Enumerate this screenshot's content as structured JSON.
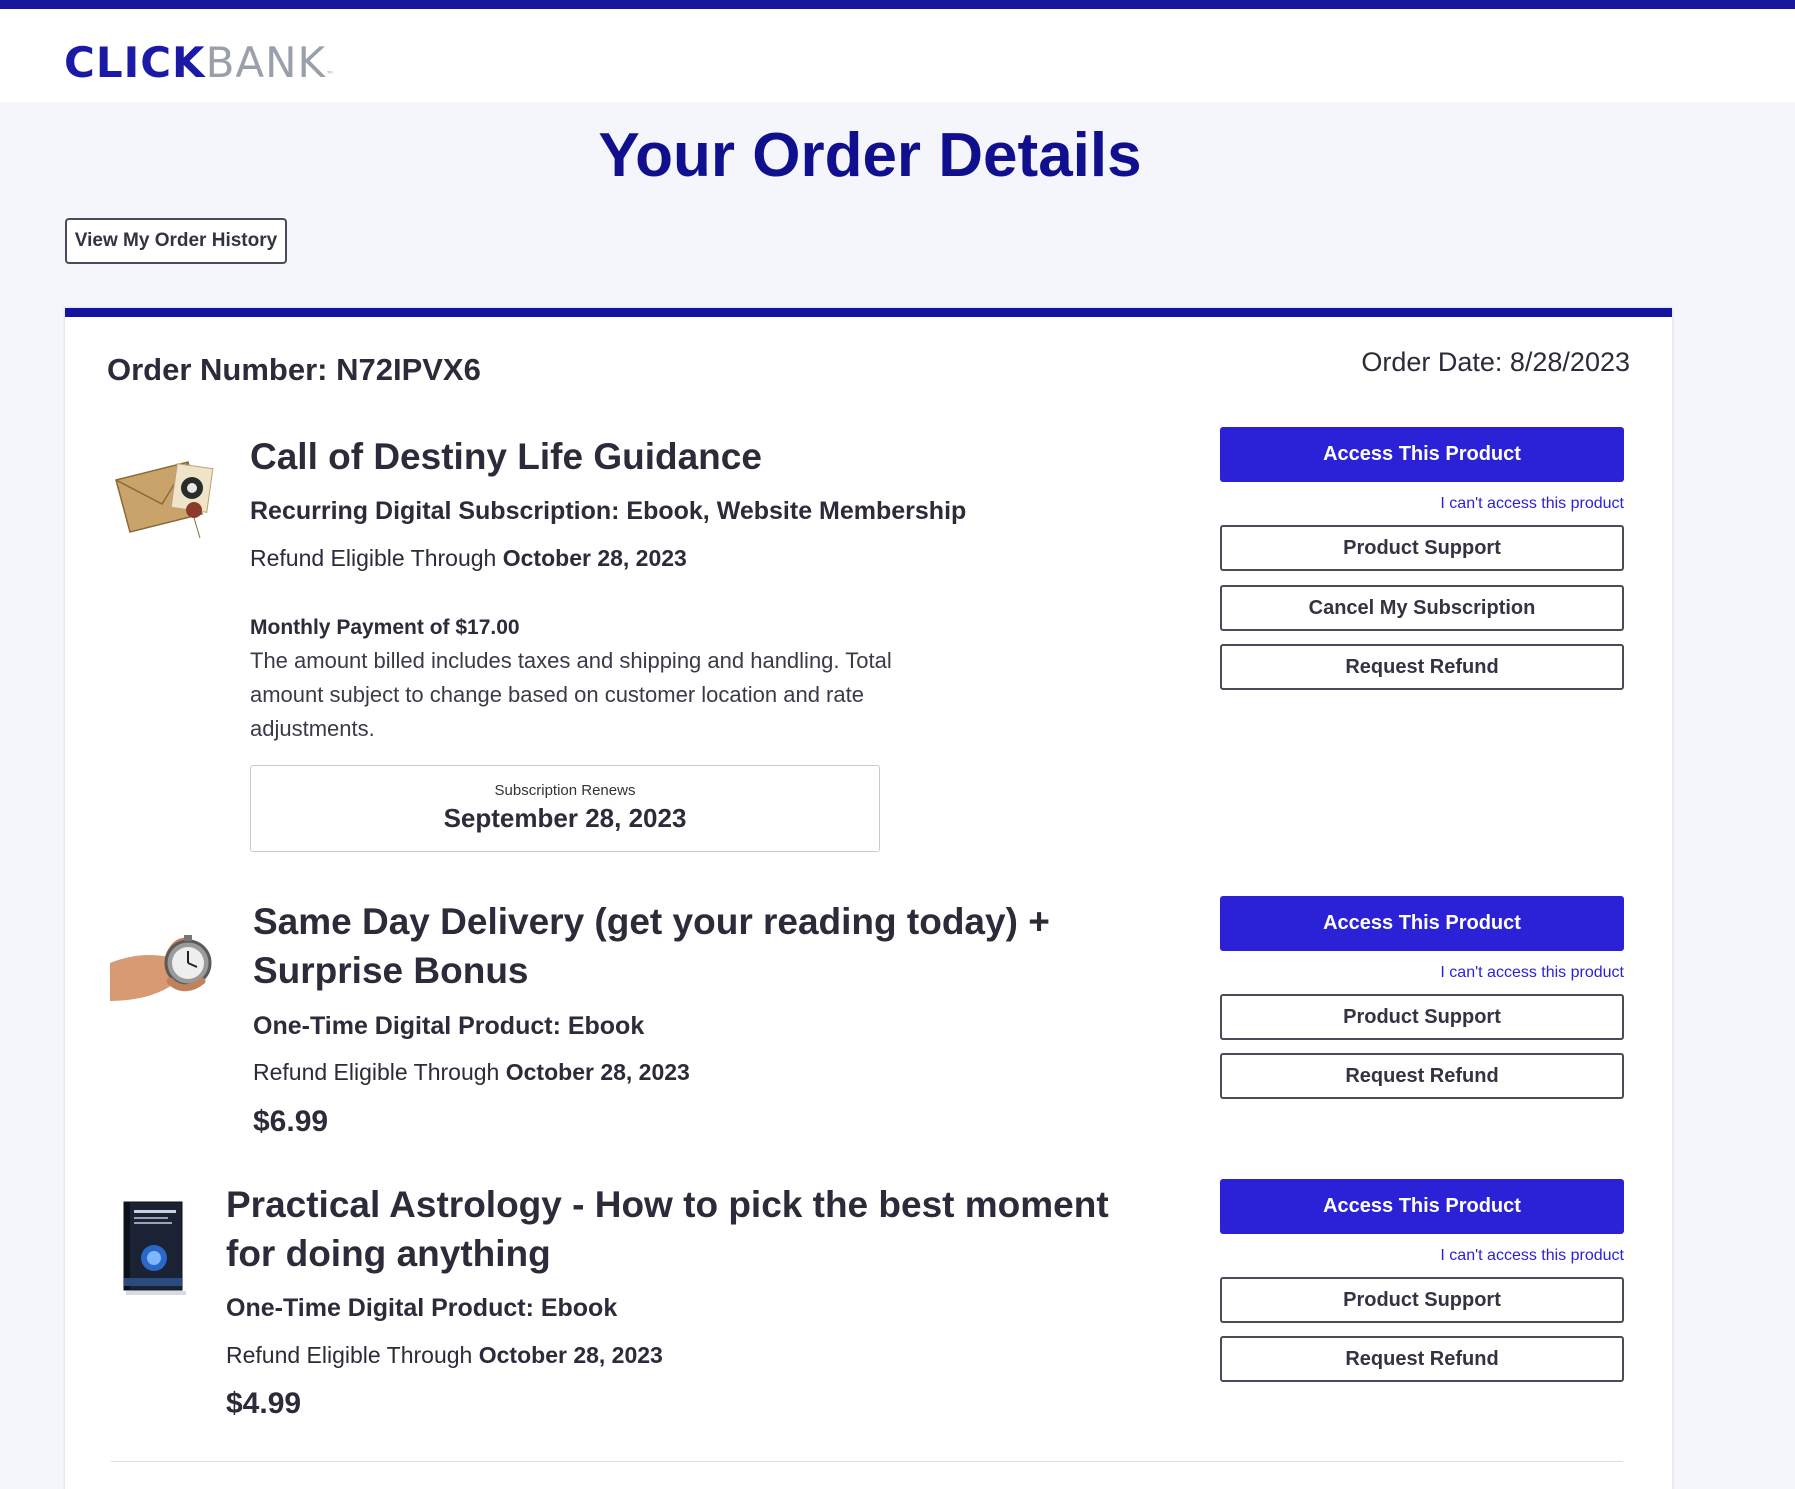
{
  "header": {
    "logo_part1": "CLICK",
    "logo_part2": "BANK",
    "logo_tm": "™"
  },
  "page": {
    "title": "Your Order Details",
    "history_button": "View My Order History"
  },
  "order": {
    "number_label": "Order Number: N72IPVX6",
    "date_label": "Order Date: 8/28/2023"
  },
  "items": [
    {
      "title": "Call of Destiny Life Guidance",
      "type": "Recurring Digital Subscription: Ebook, Website Membership",
      "refund_prefix": "Refund Eligible Through ",
      "refund_date": "October 28, 2023",
      "payment_label": "Monthly Payment of $17.00",
      "payment_note": "The amount billed includes taxes and shipping and handling. Total amount subject to change based on customer location and rate adjustments.",
      "renew_label": "Subscription Renews",
      "renew_date": "September 28, 2023",
      "access_button": "Access This Product",
      "cant_access": "I can't access this product",
      "support_button": "Product Support",
      "cancel_button": "Cancel My Subscription",
      "refund_button": "Request Refund"
    },
    {
      "title": "Same Day Delivery (get your reading today) + Surprise Bonus",
      "type": "One-Time Digital Product: Ebook",
      "refund_prefix": "Refund Eligible Through ",
      "refund_date": "October 28, 2023",
      "price": "$6.99",
      "access_button": "Access This Product",
      "cant_access": "I can't access this product",
      "support_button": "Product Support",
      "refund_button": "Request Refund"
    },
    {
      "title": "Practical Astrology - How to pick the best moment for doing anything",
      "type": "One-Time Digital Product: Ebook",
      "refund_prefix": "Refund Eligible Through ",
      "refund_date": "October 28, 2023",
      "price": "$4.99",
      "access_button": "Access This Product",
      "cant_access": "I can't access this product",
      "support_button": "Product Support",
      "refund_button": "Request Refund"
    }
  ],
  "colors": {
    "brand_navy": "#10108f",
    "accent_blue": "#2b22d8",
    "logo_gray": "#9aa0ab"
  }
}
